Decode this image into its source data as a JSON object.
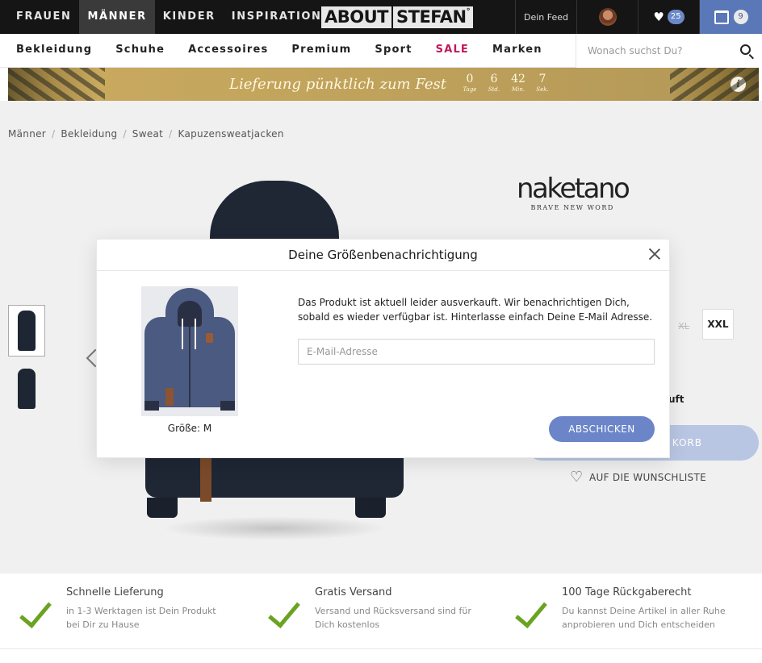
{
  "topnav": {
    "items": [
      {
        "label": "FRAUEN"
      },
      {
        "label": "MÄNNER"
      },
      {
        "label": "KINDER"
      },
      {
        "label": "INSPIRATION"
      }
    ],
    "logo_part1": "ABOUT",
    "logo_part2": "STEFAN",
    "logo_sup": "°",
    "feed_label": "Dein Feed",
    "wishlist_count": "25",
    "cart_count": "9"
  },
  "catnav": {
    "items": [
      {
        "label": "Bekleidung"
      },
      {
        "label": "Schuhe"
      },
      {
        "label": "Accessoires"
      },
      {
        "label": "Premium"
      },
      {
        "label": "Sport"
      },
      {
        "label": "SALE"
      },
      {
        "label": "Marken"
      }
    ],
    "search_placeholder": "Wonach suchst Du?"
  },
  "promo": {
    "message": "Lieferung pünktlich zum Fest",
    "countdown": [
      {
        "value": "0",
        "unit": "Tage"
      },
      {
        "value": "6",
        "unit": "Std."
      },
      {
        "value": "42",
        "unit": "Min."
      },
      {
        "value": "7",
        "unit": "Sek."
      }
    ]
  },
  "breadcrumb": [
    "Männer",
    "Bekleidung",
    "Sweat",
    "Kapuzensweatjacken"
  ],
  "product": {
    "brand": "naketano",
    "brand_tagline": "BRAVE NEW WORD",
    "size_xl": "XL",
    "size_xxl": "XXL",
    "sold_hint": "uft",
    "cart_button": "KORB",
    "wishlist_label": "AUF DIE WUNSCHLISTE"
  },
  "modal": {
    "title": "Deine Größenbenachrichtigung",
    "text": "Das Produkt ist aktuell leider ausverkauft. Wir benachrichtigen Dich, sobald es wieder verfügbar ist. Hinterlasse einfach Deine E-Mail Adresse.",
    "email_placeholder": "E-Mail-Adresse",
    "email_value": "",
    "size_label": "Größe: M",
    "submit_label": "ABSCHICKEN"
  },
  "benefits": [
    {
      "title": "Schnelle Lieferung",
      "desc1": "in 1-3 Werktagen ist Dein Produkt",
      "desc2": "bei Dir zu Hause"
    },
    {
      "title": "Gratis Versand",
      "desc1": "Versand und Rücksversand sind für",
      "desc2": "Dich kostenlos"
    },
    {
      "title": "100 Tage Rückgaberecht",
      "desc1": "Du kannst Deine Artikel in aller Ruhe",
      "desc2": "anprobieren und Dich entscheiden"
    }
  ],
  "colors": {
    "accent": "#6b85c8",
    "sale": "#c2185b",
    "check": "#6aa321"
  }
}
